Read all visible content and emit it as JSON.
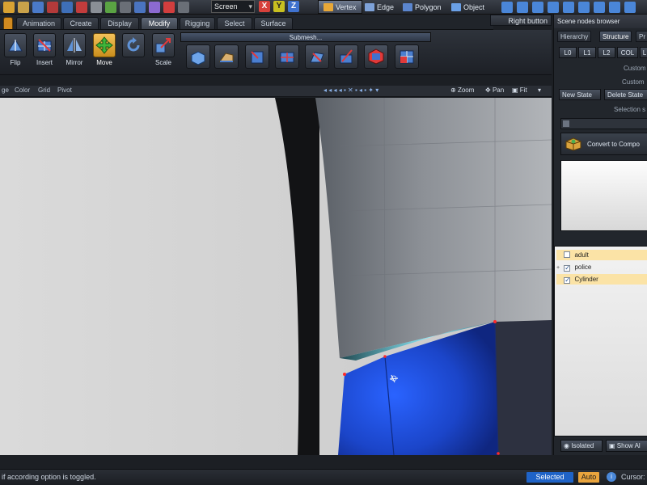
{
  "toolbar": {
    "screen_dropdown": "Screen",
    "axis_x": "X",
    "axis_y": "Y",
    "axis_z": "Z",
    "selection_modes": [
      "Vertex",
      "Edge",
      "Polygon",
      "Object"
    ],
    "right_button": "Right button"
  },
  "menu_tabs": [
    "Animation",
    "Create",
    "Display",
    "Modify",
    "Rigging",
    "Select",
    "Surface"
  ],
  "active_tab": "Modify",
  "ribbon": {
    "tools": [
      {
        "label": "Flip",
        "icon": "flip-icon"
      },
      {
        "label": "Insert",
        "icon": "insert-icon"
      },
      {
        "label": "Mirror",
        "icon": "mirror-icon"
      },
      {
        "label": "Move",
        "icon": "move-icon"
      },
      {
        "label": "",
        "icon": "rotate-icon"
      },
      {
        "label": "Scale",
        "icon": "scale-icon"
      }
    ],
    "submesh_label": "Submesh..."
  },
  "viewport": {
    "menus": [
      "ge",
      "Color",
      "Grid",
      "Pivot"
    ],
    "controls": [
      "Zoom",
      "Pan",
      "Fit"
    ]
  },
  "scene_panel": {
    "title": "Scene nodes browser",
    "tabs": [
      "Hierarchy",
      "Structure",
      "Pr"
    ],
    "active_tab": "Structure",
    "lod_buttons": [
      "L0",
      "L1",
      "L2",
      "COL",
      "L"
    ],
    "custom_1": "Custom",
    "custom_2": "Custom",
    "new_state": "New State",
    "delete_state": "Delete State",
    "selection_label": "Selection s",
    "convert_button": "Convert to Compo",
    "tree": [
      {
        "label": "adult",
        "checked": false,
        "selected": true,
        "expandable": false
      },
      {
        "label": "police",
        "checked": true,
        "selected": false,
        "expandable": true
      },
      {
        "label": "Cylinder",
        "checked": true,
        "selected": true,
        "expandable": false
      }
    ],
    "isolated_button": "Isolated",
    "show_all_button": "Show Al"
  },
  "statusbar": {
    "message": "if according option is toggled.",
    "selected_badge": "Selected",
    "auto_badge": "Auto",
    "cursor_label": "Cursor:"
  },
  "colors": {
    "active_tool": "#f4c25a",
    "selected_badge": "#1f63c7",
    "auto_badge": "#e9a43d",
    "mesh_blue": "#1f4fd8"
  }
}
